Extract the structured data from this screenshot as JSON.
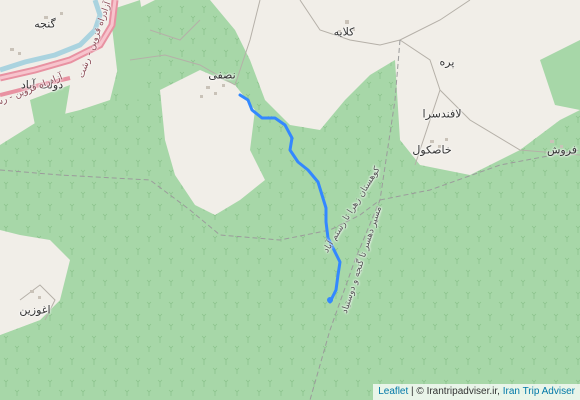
{
  "map": {
    "place_labels": {
      "ganjeh": "گنجه",
      "kalayeh": "کلایه",
      "nasfi": "نصفی",
      "dowlatabad": "دولت آباد",
      "pareh": "پره",
      "lafandsara": "لافندسرا",
      "khaskul": "خاصکول",
      "forush": "فروش",
      "aghozin": "اغوزین"
    },
    "road_labels": {
      "freeway_1": "آزادراه قزوین - رشت",
      "freeway_2": "آزادراه قزوین - رشت",
      "trail_1": "کوهستان زهرا تا رستم آباد",
      "trail_2": "مسیر دهسر تا گنجه و دوستیاد"
    }
  },
  "attribution": {
    "leaflet": "Leaflet",
    "separator": " | © ",
    "provider": "Irantripadviser.ir",
    "comma": ", ",
    "site": "Iran Trip Adviser"
  },
  "colors": {
    "land": "#f1eee8",
    "forest": "#a7d7a8",
    "tree_symbol": "#8cc38d",
    "route": "#3388ff",
    "freeway": "#e892a2",
    "river": "#aad3df",
    "link": "#0078A8"
  }
}
